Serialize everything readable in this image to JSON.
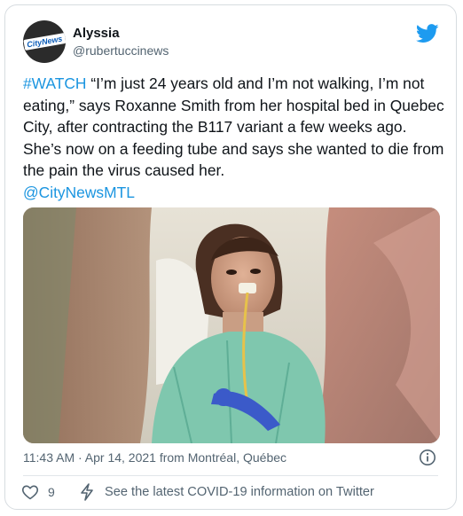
{
  "author": {
    "name": "Alyssia",
    "handle": "@rubertuccinews",
    "avatar_logo": "CityNews"
  },
  "tweet": {
    "hashtag": "#WATCH",
    "body": " “I’m just 24 years old and I’m not walking, I’m not eating,” says Roxanne Smith from her hospital bed in Quebec City, after contracting the B117 variant a few weeks ago. She’s now on a feeding tube and says she wanted to die from the pain the virus caused her.",
    "mention": "@CityNewsMTL"
  },
  "meta": {
    "timestamp": "11:43 AM · Apr 14, 2021 from Montréal, Québec"
  },
  "actions": {
    "like_count": "9",
    "covid_info": "See the latest COVID-19 information on Twitter"
  },
  "icons": {
    "logo": "twitter-bird-icon",
    "info": "info-icon",
    "like": "heart-icon",
    "covid": "lightning-bolt-icon"
  },
  "colors": {
    "brand": "#1d9bf0",
    "link": "#1b95e0",
    "muted": "#536471"
  }
}
